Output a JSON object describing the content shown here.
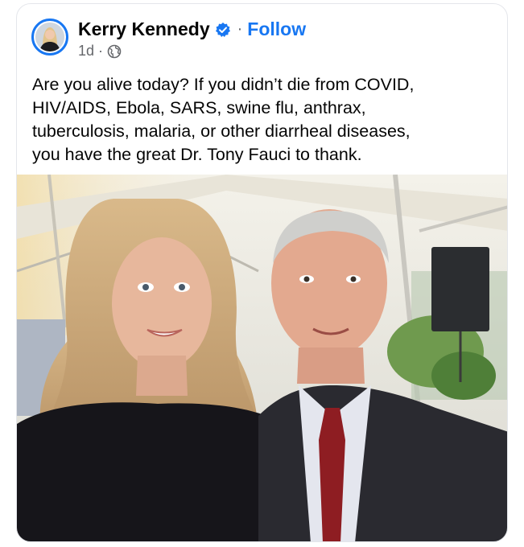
{
  "post": {
    "author": {
      "name": "Kerry Kennedy",
      "verified_icon": "verified-badge-icon",
      "avatar_icon": "avatar-icon"
    },
    "follow_separator": "·",
    "follow_label": "Follow",
    "timestamp": "1d",
    "meta_separator": "·",
    "audience_icon": "globe-icon",
    "text": "Are you alive today? If you didn’t die from COVID,\nHIV/AIDS, Ebola, SARS, swine flu, anthrax,\ntuberculosis, malaria, or other diarrheal diseases,\nyou have the great Dr. Tony Fauci to thank.",
    "photo_icon": "event-photo-image"
  },
  "colors": {
    "link_blue": "#1877f2",
    "muted_text": "#65676b",
    "border": "#e4e6eb"
  }
}
